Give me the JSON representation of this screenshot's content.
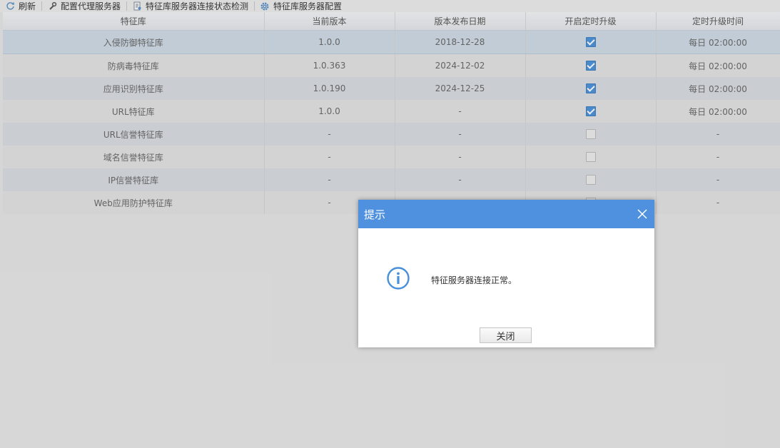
{
  "toolbar": {
    "refresh": "刷新",
    "config_proxy": "配置代理服务器",
    "check_status": "特征库服务器连接状态检测",
    "server_config": "特征库服务器配置"
  },
  "table": {
    "columns": [
      "特征库",
      "当前版本",
      "版本发布日期",
      "开启定时升级",
      "定时升级时间"
    ],
    "rows": [
      {
        "name": "入侵防御特征库",
        "version": "1.0.0",
        "date": "2018-12-28",
        "enabled": true,
        "time": "每日 02:00:00"
      },
      {
        "name": "防病毒特征库",
        "version": "1.0.363",
        "date": "2024-12-02",
        "enabled": true,
        "time": "每日 02:00:00"
      },
      {
        "name": "应用识别特征库",
        "version": "1.0.190",
        "date": "2024-12-25",
        "enabled": true,
        "time": "每日 02:00:00"
      },
      {
        "name": "URL特征库",
        "version": "1.0.0",
        "date": "-",
        "enabled": true,
        "time": "每日 02:00:00"
      },
      {
        "name": "URL信誉特征库",
        "version": "-",
        "date": "-",
        "enabled": false,
        "time": "-"
      },
      {
        "name": "域名信誉特征库",
        "version": "-",
        "date": "-",
        "enabled": false,
        "time": "-"
      },
      {
        "name": "IP信誉特征库",
        "version": "-",
        "date": "-",
        "enabled": false,
        "time": "-"
      },
      {
        "name": "Web应用防护特征库",
        "version": "-",
        "date": "-",
        "enabled": false,
        "time": "-"
      }
    ]
  },
  "dialog": {
    "title": "提示",
    "message": "特征服务器连接正常。",
    "close_button": "关闭",
    "icon": "info-icon"
  },
  "colors": {
    "dialog_header": "#4f90df",
    "checkbox_on": "#4a90d9"
  }
}
